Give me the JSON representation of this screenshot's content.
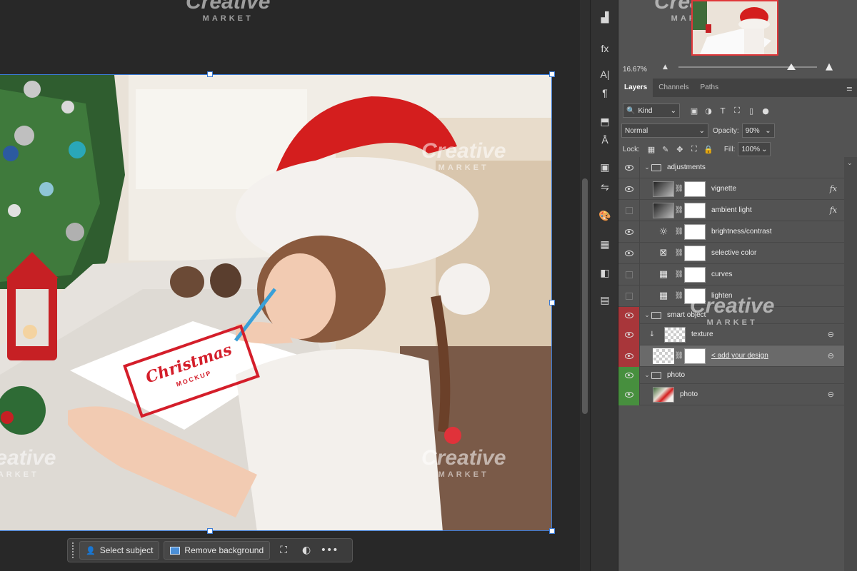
{
  "watermark": {
    "title": "Creative",
    "subtitle": "MARKET"
  },
  "canvas": {
    "mockup_card": {
      "script": "Christmas",
      "label": "MOCKUP"
    }
  },
  "taskbar": {
    "select_subject": "Select subject",
    "remove_background": "Remove background",
    "more": "•••"
  },
  "navigator": {
    "zoom": "16.67%"
  },
  "tabs": [
    {
      "label": "Layers"
    },
    {
      "label": "Channels"
    },
    {
      "label": "Paths"
    }
  ],
  "filter": {
    "kind": "Kind"
  },
  "blend": {
    "mode": "Normal",
    "opacity_label": "Opacity:",
    "opacity": "90%"
  },
  "lock": {
    "label": "Lock:",
    "fill_label": "Fill:",
    "fill": "100%"
  },
  "layers": [
    {
      "name": "adjustments"
    },
    {
      "name": "vignette"
    },
    {
      "name": "ambient light"
    },
    {
      "name": "brightness/contrast"
    },
    {
      "name": "selective color"
    },
    {
      "name": "curves"
    },
    {
      "name": "lighten"
    },
    {
      "name": "smart object"
    },
    {
      "name": "texture"
    },
    {
      "name": "< add your design"
    },
    {
      "name": "photo"
    },
    {
      "name": "photo"
    }
  ],
  "icons": {
    "fx": "fx",
    "paragraph": "¶",
    "char": "A|"
  },
  "colors": {
    "accent": "#3b7bd6",
    "red_tag": "#a8363a",
    "green_tag": "#478f3e",
    "hat_red": "#d41e1e"
  }
}
